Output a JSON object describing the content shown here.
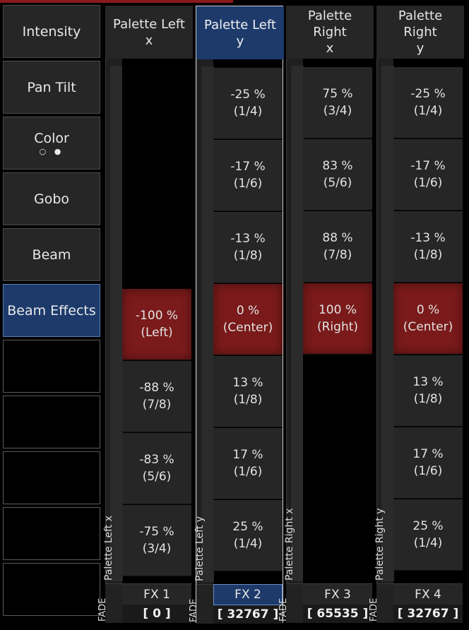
{
  "sidebar": {
    "items": [
      {
        "label": "Intensity",
        "active": false
      },
      {
        "label": "Pan Tilt",
        "active": false
      },
      {
        "label": "Color",
        "active": false,
        "dots": "○ ●"
      },
      {
        "label": "Gobo",
        "active": false
      },
      {
        "label": "Beam",
        "active": false
      },
      {
        "label": "Beam Effects",
        "active": true
      }
    ],
    "empty_slots": 5
  },
  "columns": [
    {
      "header": "Palette Left x",
      "fader_label": "Palette Left x",
      "selected": false,
      "cells": [
        {
          "pct": "-100 %",
          "frac": "(Left)",
          "active": true
        },
        {
          "pct": "-88 %",
          "frac": "(7/8)",
          "active": false
        },
        {
          "pct": "-83 %",
          "frac": "(5/6)",
          "active": false
        },
        {
          "pct": "-75 %",
          "frac": "(3/4)",
          "active": false
        }
      ],
      "fade": "FADE",
      "fx_label": "FX 1",
      "fx_value": "[ 0 ]"
    },
    {
      "header": "Palette Left y",
      "fader_label": "Palette Left y",
      "selected": true,
      "cells": [
        {
          "pct": "-25 %",
          "frac": "(1/4)",
          "active": false
        },
        {
          "pct": "-17 %",
          "frac": "(1/6)",
          "active": false
        },
        {
          "pct": "-13 %",
          "frac": "(1/8)",
          "active": false
        },
        {
          "pct": "0 %",
          "frac": "(Center)",
          "active": true
        },
        {
          "pct": "13 %",
          "frac": "(1/8)",
          "active": false
        },
        {
          "pct": "17 %",
          "frac": "(1/6)",
          "active": false
        },
        {
          "pct": "25 %",
          "frac": "(1/4)",
          "active": false
        }
      ],
      "fade": "FADE",
      "fx_label": "FX 2",
      "fx_value": "[ 32767 ]"
    },
    {
      "header_line1": "Palette Right",
      "header_line2": "x",
      "fader_label": "Palette Right x",
      "selected": false,
      "cells": [
        {
          "pct": "75 %",
          "frac": "(3/4)",
          "active": false
        },
        {
          "pct": "83 %",
          "frac": "(5/6)",
          "active": false
        },
        {
          "pct": "88 %",
          "frac": "(7/8)",
          "active": false
        },
        {
          "pct": "100 %",
          "frac": "(Right)",
          "active": true
        }
      ],
      "fade": "FADE",
      "fx_label": "FX 3",
      "fx_value": "[ 65535 ]"
    },
    {
      "header_line1": "Palette Right",
      "header_line2": "y",
      "fader_label": "Palette Right y",
      "selected": false,
      "cells": [
        {
          "pct": "-25 %",
          "frac": "(1/4)",
          "active": false
        },
        {
          "pct": "-17 %",
          "frac": "(1/6)",
          "active": false
        },
        {
          "pct": "-13 %",
          "frac": "(1/8)",
          "active": false
        },
        {
          "pct": "0 %",
          "frac": "(Center)",
          "active": true
        },
        {
          "pct": "13 %",
          "frac": "(1/8)",
          "active": false
        },
        {
          "pct": "17 %",
          "frac": "(1/6)",
          "active": false
        },
        {
          "pct": "25 %",
          "frac": "(1/4)",
          "active": false
        }
      ],
      "fade": "FADE",
      "fx_label": "FX 4",
      "fx_value": "[ 32767 ]"
    }
  ],
  "colors": {
    "active_blue": "#1d3a6b",
    "active_red": "#7a1a1a",
    "cell_bg": "#262626"
  }
}
